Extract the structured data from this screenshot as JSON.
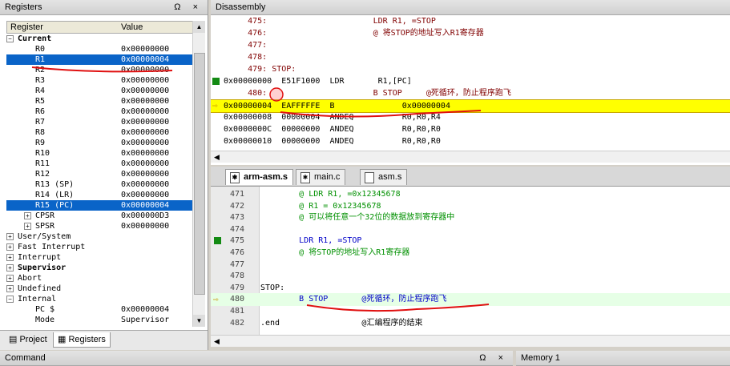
{
  "registers_panel": {
    "title": "Registers",
    "controls": "Ω ×",
    "col_register": "Register",
    "col_value": "Value",
    "rows": [
      {
        "name": "Current",
        "value": "",
        "indent": 1,
        "bold": true,
        "toggle": "−"
      },
      {
        "name": "R0",
        "value": "0x00000000",
        "indent": 3
      },
      {
        "name": "R1",
        "value": "0x00000004",
        "indent": 3,
        "selected": true
      },
      {
        "name": "R2",
        "value": "0x00000000",
        "indent": 3
      },
      {
        "name": "R3",
        "value": "0x00000000",
        "indent": 3
      },
      {
        "name": "R4",
        "value": "0x00000000",
        "indent": 3
      },
      {
        "name": "R5",
        "value": "0x00000000",
        "indent": 3
      },
      {
        "name": "R6",
        "value": "0x00000000",
        "indent": 3
      },
      {
        "name": "R7",
        "value": "0x00000000",
        "indent": 3
      },
      {
        "name": "R8",
        "value": "0x00000000",
        "indent": 3
      },
      {
        "name": "R9",
        "value": "0x00000000",
        "indent": 3
      },
      {
        "name": "R10",
        "value": "0x00000000",
        "indent": 3
      },
      {
        "name": "R11",
        "value": "0x00000000",
        "indent": 3
      },
      {
        "name": "R12",
        "value": "0x00000000",
        "indent": 3
      },
      {
        "name": "R13 (SP)",
        "value": "0x00000000",
        "indent": 3
      },
      {
        "name": "R14 (LR)",
        "value": "0x00000000",
        "indent": 3
      },
      {
        "name": "R15 (PC)",
        "value": "0x00000004",
        "indent": 3,
        "selected": true
      },
      {
        "name": "CPSR",
        "value": "0x000000D3",
        "indent": 3,
        "toggle": "+"
      },
      {
        "name": "SPSR",
        "value": "0x00000000",
        "indent": 3,
        "toggle": "+"
      },
      {
        "name": "User/System",
        "value": "",
        "indent": 1,
        "toggle": "+"
      },
      {
        "name": "Fast Interrupt",
        "value": "",
        "indent": 1,
        "toggle": "+"
      },
      {
        "name": "Interrupt",
        "value": "",
        "indent": 1,
        "toggle": "+"
      },
      {
        "name": "Supervisor",
        "value": "",
        "indent": 1,
        "bold": true,
        "toggle": "+"
      },
      {
        "name": "Abort",
        "value": "",
        "indent": 1,
        "toggle": "+"
      },
      {
        "name": "Undefined",
        "value": "",
        "indent": 1,
        "toggle": "+"
      },
      {
        "name": "Internal",
        "value": "",
        "indent": 1,
        "toggle": "−"
      },
      {
        "name": "PC  $",
        "value": "0x00000004",
        "indent": 3
      },
      {
        "name": "Mode",
        "value": "Supervisor",
        "indent": 3
      }
    ],
    "tabs": {
      "project": "Project",
      "registers": "Registers"
    }
  },
  "disassembly": {
    "title": "Disassembly",
    "lines": [
      {
        "text": "     475:                      LDR R1, =STOP",
        "style": "maroon"
      },
      {
        "text": "     476:                      @ 将STOP的地址写入R1寄存器",
        "style": "maroon"
      },
      {
        "text": "     477:",
        "style": "maroon"
      },
      {
        "text": "     478:",
        "style": "maroon"
      },
      {
        "text": "     479: STOP:",
        "style": "maroon"
      },
      {
        "text": "0x00000000  E51F1000  LDR       R1,[PC]",
        "style": "normal",
        "marker": "bp"
      },
      {
        "text": "     480:                      B STOP     @死循环，防止程序跑飞",
        "style": "maroon"
      },
      {
        "text": "0x00000004  EAFFFFFE  B              0x00000004",
        "style": "highlight",
        "marker": "arrow"
      },
      {
        "text": "0x00000008  00000004  ANDEQ          R0,R0,R4",
        "style": "normal"
      },
      {
        "text": "0x0000000C  00000000  ANDEQ          R0,R0,R0",
        "style": "normal"
      },
      {
        "text": "0x00000010  00000000  ANDEQ          R0,R0,R0",
        "style": "normal"
      }
    ]
  },
  "editor": {
    "tabs": [
      {
        "label": "arm-asm.s",
        "active": true
      },
      {
        "label": "main.c",
        "active": false
      },
      {
        "label": "asm.s",
        "active": false
      }
    ],
    "lines": [
      {
        "num": "471",
        "parts": [
          {
            "t": "        @ LDR R1, =0x12345678",
            "c": "cmt"
          }
        ]
      },
      {
        "num": "472",
        "parts": [
          {
            "t": "        @ R1 = 0x12345678",
            "c": "cmt"
          }
        ]
      },
      {
        "num": "473",
        "parts": [
          {
            "t": "        @ 可以将任意一个32位的数据放到寄存器中",
            "c": "cmt"
          }
        ]
      },
      {
        "num": "474",
        "parts": []
      },
      {
        "num": "475",
        "parts": [
          {
            "t": "        LDR R1, =STOP",
            "c": "kw"
          }
        ],
        "marker": "bp"
      },
      {
        "num": "476",
        "parts": [
          {
            "t": "        @ 将STOP的地址写入R1寄存器",
            "c": "cmt"
          }
        ]
      },
      {
        "num": "477",
        "parts": []
      },
      {
        "num": "478",
        "parts": []
      },
      {
        "num": "479",
        "parts": [
          {
            "t": "STOP:",
            "c": ""
          }
        ]
      },
      {
        "num": "480",
        "parts": [
          {
            "t": "        B STOP       @死循环，防止程序跑飞",
            "c": "kw"
          }
        ],
        "marker": "arrow",
        "current": true
      },
      {
        "num": "481",
        "parts": []
      },
      {
        "num": "482",
        "parts": [
          {
            "t": ".end                 @汇编程序的结束",
            "c": ""
          }
        ]
      }
    ]
  },
  "bottom": {
    "command_title": "Command",
    "command_controls": "Ω ×",
    "memory_title": "Memory 1"
  },
  "colors": {
    "selection": "#0a64c8",
    "highlight": "#ffff00",
    "annotation": "#e01010",
    "breakpoint": "#138a13"
  }
}
